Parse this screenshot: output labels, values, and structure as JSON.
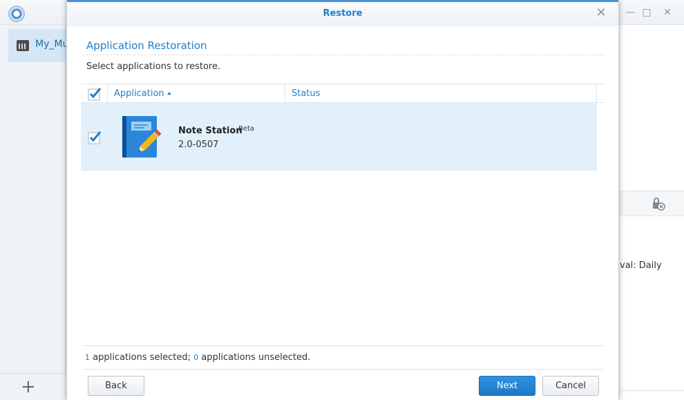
{
  "background_app": {
    "sidebar": {
      "items": [
        {
          "label": "My_Mu"
        }
      ]
    },
    "right_panel": {
      "interval_text": "val: Daily"
    },
    "add_label": "+"
  },
  "dialog": {
    "title": "Restore",
    "section_title": "Application Restoration",
    "instructions": "Select applications to restore.",
    "table": {
      "columns": [
        "Application",
        "Status"
      ],
      "rows": [
        {
          "name": "Note Station",
          "tag": "Beta",
          "version": "2.0-0507",
          "status": "",
          "checked": true
        }
      ]
    },
    "summary": {
      "selected_count": "1",
      "selected_text": " applications selected; ",
      "unselected_count": "0",
      "unselected_text": " applications unselected."
    },
    "buttons": {
      "back": "Back",
      "next": "Next",
      "cancel": "Cancel"
    }
  },
  "colors": {
    "accent": "#1f7fc9",
    "row_highlight": "#e1f0fb",
    "primary_button": "#1e78c6"
  },
  "icons": [
    "app-logo-icon",
    "server-icon",
    "plus-icon",
    "lock-remove-icon",
    "close-icon",
    "checkbox-checked-icon",
    "note-station-icon",
    "sort-ascending-icon"
  ]
}
